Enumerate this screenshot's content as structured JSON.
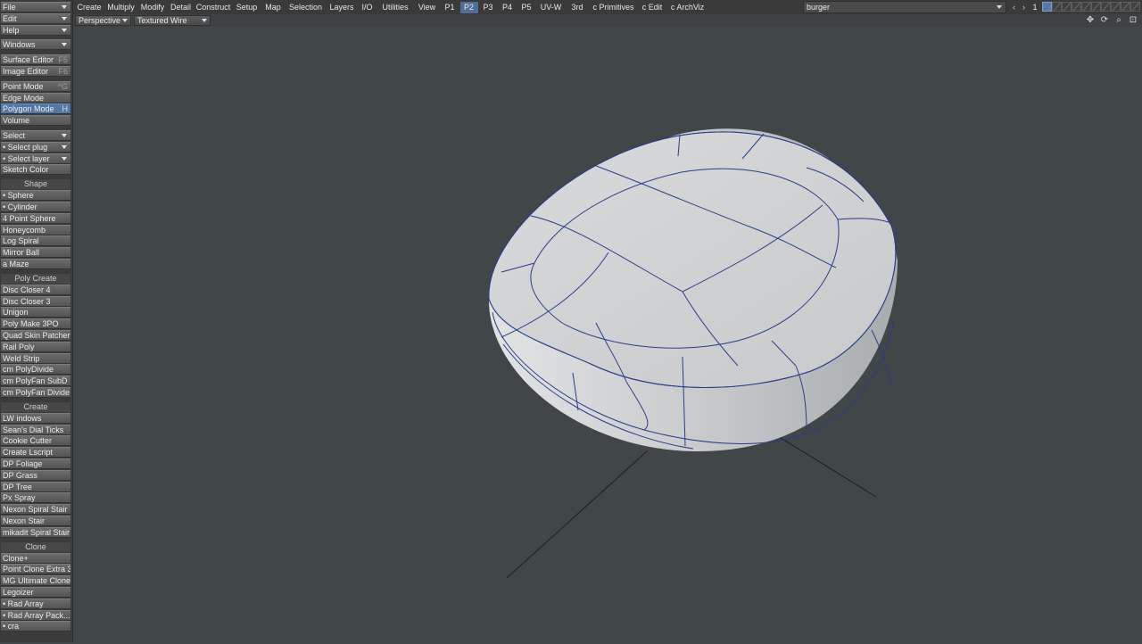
{
  "sidebar": {
    "rows": [
      {
        "label": "File",
        "dropdown": true
      },
      {
        "label": "Edit",
        "dropdown": true
      },
      {
        "label": "Help",
        "dropdown": true
      },
      {
        "label": "Windows",
        "dropdown": true
      },
      {
        "label": "Surface Editor",
        "key": "F5"
      },
      {
        "label": "Image Editor",
        "key": "F6"
      },
      {
        "label": "Point Mode",
        "key": "^G"
      },
      {
        "label": "Edge Mode"
      },
      {
        "label": "Polygon Mode",
        "key": "H",
        "active": true
      },
      {
        "label": "Volume"
      },
      {
        "label": "Select",
        "dropdown": true
      },
      {
        "label": "• Select plug",
        "dropdown": true
      },
      {
        "label": "• Select layer",
        "dropdown": true
      },
      {
        "label": "Sketch Color"
      },
      {
        "group": "Shape"
      },
      {
        "label": "•   Sphere"
      },
      {
        "label": "•   Cylinder"
      },
      {
        "label": "4 Point Sphere"
      },
      {
        "label": "Honeycomb"
      },
      {
        "label": "Log Spiral"
      },
      {
        "label": "Mirror Ball"
      },
      {
        "label": "a Maze"
      },
      {
        "group": "Poly Create"
      },
      {
        "label": "Disc Closer 4"
      },
      {
        "label": "Disc Closer 3"
      },
      {
        "label": "Unigon"
      },
      {
        "label": "Poly Make 3PO"
      },
      {
        "label": "Quad Skin Patcher"
      },
      {
        "label": "Rail Poly"
      },
      {
        "label": "Weld Strip"
      },
      {
        "label": "cm PolyDivide"
      },
      {
        "label": "cm PolyFan SubD"
      },
      {
        "label": "cm PolyFan Divide"
      },
      {
        "group": "Create"
      },
      {
        "label": "LW indows"
      },
      {
        "label": "Sean's Dial Ticks"
      },
      {
        "label": "Cookie Cutter"
      },
      {
        "label": "Create Lscript"
      },
      {
        "label": "DP Foliage"
      },
      {
        "label": "DP Grass"
      },
      {
        "label": "DP Tree"
      },
      {
        "label": "Px Spray"
      },
      {
        "label": "Nexon Spiral Stair"
      },
      {
        "label": "Nexon Stair"
      },
      {
        "label": "mikadit Spiral Stair"
      },
      {
        "group": "Clone"
      },
      {
        "label": "Clone+"
      },
      {
        "label": "Point Clone Extra 3"
      },
      {
        "label": "MG Ultimate Clone"
      },
      {
        "label": "Legoizer"
      },
      {
        "label": "• Rad Array"
      },
      {
        "label": "• Rad Array Pack..."
      },
      {
        "label": "• cra"
      }
    ]
  },
  "toolbar": {
    "tabs": [
      {
        "label": "Create"
      },
      {
        "label": "Multiply"
      },
      {
        "label": "Modify"
      },
      {
        "label": "Detail"
      },
      {
        "label": "Construct"
      },
      {
        "label": "Setup"
      },
      {
        "label": "Map"
      },
      {
        "label": "Selection"
      },
      {
        "label": "Layers"
      },
      {
        "label": "I/O"
      },
      {
        "label": "Utilities"
      },
      {
        "label": "View"
      },
      {
        "label": "P1"
      },
      {
        "label": "P2",
        "active": true
      },
      {
        "label": "P3"
      },
      {
        "label": "P4"
      },
      {
        "label": "P5"
      },
      {
        "label": "UV-W"
      },
      {
        "label": "3rd"
      },
      {
        "label": "c Primitives"
      },
      {
        "label": "c Edit"
      },
      {
        "label": "c ArchViz"
      }
    ],
    "object_name": "burger",
    "layer_number": "1",
    "layer_slots": 10,
    "active_layer_slot": 1
  },
  "viewport": {
    "view_mode": "Perspective",
    "render_mode": "Textured Wire",
    "background_color": "#414649",
    "mesh_fill_color": "#d2d4d6",
    "wire_color": "#2a3d8a",
    "axis_color": "#1d1f21",
    "icons": [
      "move-view-icon",
      "rotate-view-icon",
      "zoom-view-icon",
      "maximize-view-icon"
    ]
  }
}
